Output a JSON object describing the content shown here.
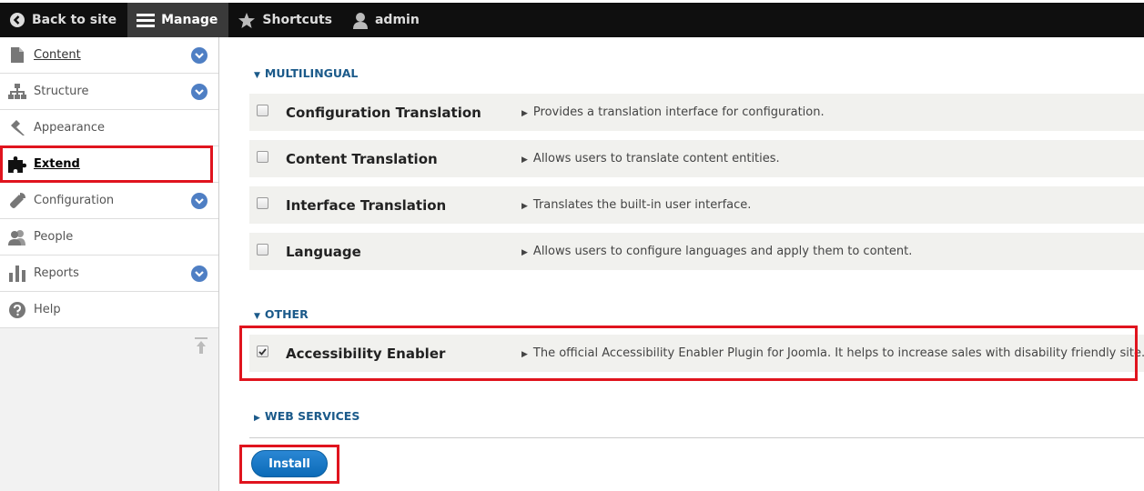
{
  "toolbar": {
    "back_label": "Back to site",
    "manage_label": "Manage",
    "shortcuts_label": "Shortcuts",
    "user_label": "admin"
  },
  "sidebar": {
    "items": [
      {
        "label": "Content",
        "icon": "file-icon"
      },
      {
        "label": "Structure",
        "icon": "sitemap-icon"
      },
      {
        "label": "Appearance",
        "icon": "paintbrush-icon"
      },
      {
        "label": "Extend",
        "icon": "puzzle-icon"
      },
      {
        "label": "Configuration",
        "icon": "wrench-icon"
      },
      {
        "label": "People",
        "icon": "people-icon"
      },
      {
        "label": "Reports",
        "icon": "bar-chart-icon"
      },
      {
        "label": "Help",
        "icon": "help-icon"
      }
    ]
  },
  "sections": {
    "multilingual": "MULTILINGUAL",
    "other": "OTHER",
    "web_services": "WEB SERVICES"
  },
  "modules": [
    {
      "name": "Configuration Translation",
      "desc": "Provides a translation interface for configuration.",
      "checked": false
    },
    {
      "name": "Content Translation",
      "desc": "Allows users to translate content entities.",
      "checked": false
    },
    {
      "name": "Interface Translation",
      "desc": "Translates the built-in user interface.",
      "checked": false
    },
    {
      "name": "Language",
      "desc": "Allows users to configure languages and apply them to content.",
      "checked": false
    },
    {
      "name": "Accessibility Enabler",
      "desc": "The official Accessibility Enabler Plugin for Joomla. It helps to increase sales with disability friendly site.",
      "checked": true
    }
  ],
  "actions": {
    "install_label": "Install"
  },
  "colors": {
    "highlight": "#e0141e",
    "accent": "#1b5a8a",
    "button": "#0b6bb8"
  }
}
